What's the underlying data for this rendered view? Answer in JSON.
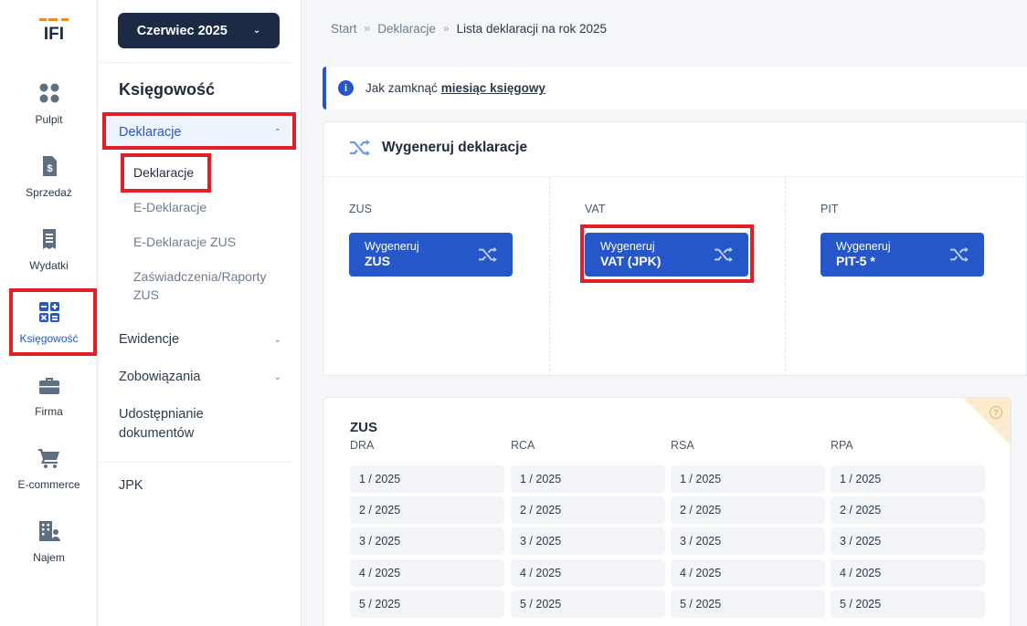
{
  "logo": {
    "text": "IFI"
  },
  "rail": [
    {
      "label": "Pulpit",
      "icon": "dashboard-icon"
    },
    {
      "label": "Sprzedaż",
      "icon": "invoice-icon"
    },
    {
      "label": "Wydatki",
      "icon": "receipt-icon"
    },
    {
      "label": "Księgowość",
      "icon": "calculator-icon"
    },
    {
      "label": "Firma",
      "icon": "briefcase-icon"
    },
    {
      "label": "E-commerce",
      "icon": "cart-icon"
    },
    {
      "label": "Najem",
      "icon": "building-icon"
    }
  ],
  "month_selector": {
    "label": "Czerwiec 2025"
  },
  "subnav": {
    "title": "Księgowość",
    "deklaracje": {
      "label": "Deklaracje",
      "items": [
        "Deklaracje",
        "E-Deklaracje",
        "E-Deklaracje ZUS",
        "Zaświadczenia/Raporty",
        "ZUS"
      ]
    },
    "ewidencje": "Ewidencje",
    "zobowiazania": "Zobowiązania",
    "udostepnianie_1": "Udostępnianie",
    "udostepnianie_2": "dokumentów",
    "jpk": "JPK"
  },
  "breadcrumb": [
    "Start",
    "Deklaracje",
    "Lista deklaracji na rok 2025"
  ],
  "info": {
    "text": "Jak zamknąć",
    "link": "miesiąc księgowy"
  },
  "generate": {
    "title": "Wygeneruj deklaracje",
    "columns": [
      {
        "label": "ZUS",
        "btn_top": "Wygeneruj",
        "btn_bottom": "ZUS"
      },
      {
        "label": "VAT",
        "btn_top": "Wygeneruj",
        "btn_bottom": "VAT (JPK)"
      },
      {
        "label": "PIT",
        "btn_top": "Wygeneruj",
        "btn_bottom": "PIT-5 *"
      }
    ]
  },
  "zus_section": {
    "title": "ZUS",
    "corner_icon": "?",
    "columns": [
      "DRA",
      "RCA",
      "RSA",
      "RPA"
    ],
    "rows": [
      "1 / 2025",
      "2 / 2025",
      "3 / 2025",
      "4 / 2025",
      "5 / 2025"
    ]
  },
  "colors": {
    "accent": "#2557c8",
    "dark": "#1d2a45",
    "highlight": "#e01f26"
  }
}
